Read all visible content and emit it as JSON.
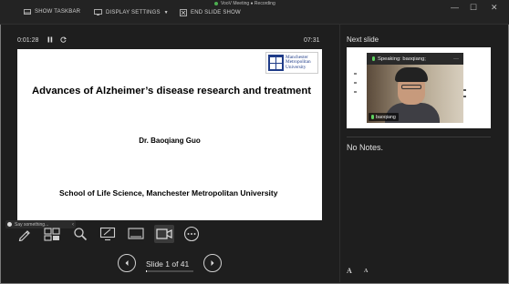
{
  "window": {
    "toolbar": {
      "show_taskbar": "SHOW TASKBAR",
      "display_settings": "DISPLAY SETTINGS",
      "display_settings_arrow": "▼",
      "end_slide_show": "END SLIDE SHOW"
    },
    "meeting_status": "VooV Meeting  ● Recording",
    "controls": {
      "minimize": "—",
      "maximize": "☐",
      "close": "✕"
    }
  },
  "presenter": {
    "elapsed_time": "0:01:28",
    "clock": "07:31",
    "pause_icon": "pause-icon",
    "restart_icon": "restart-icon"
  },
  "slide": {
    "logo_line1": "Manchester",
    "logo_line2": "Metropolitan",
    "logo_line3": "University",
    "title": "Advances of Alzheimer’s disease research and treatment",
    "author": "Dr. Baoqiang Guo",
    "affiliation": "School of Life Science, Manchester Metropolitan University"
  },
  "chat": {
    "placeholder": "Say something...",
    "close": "‹"
  },
  "tools": [
    "pen-icon",
    "slides-grid-icon",
    "zoom-icon",
    "pointer-screen-icon",
    "subtitles-icon",
    "camera-icon",
    "more-icon"
  ],
  "navigation": {
    "counter": "Slide 1 of 41",
    "current": 1,
    "total": 41
  },
  "next_slide": {
    "label": "Next slide"
  },
  "video": {
    "speaking": "Speaking: baoqiang;",
    "participant_name": "baoqiang"
  },
  "notes": {
    "text": "No Notes."
  },
  "font_controls": {
    "increase": "A",
    "decrease": "A"
  },
  "colors": {
    "background": "#1e1e1e",
    "mic_active": "#5fd35f",
    "logo_blue": "#1f3c88"
  }
}
